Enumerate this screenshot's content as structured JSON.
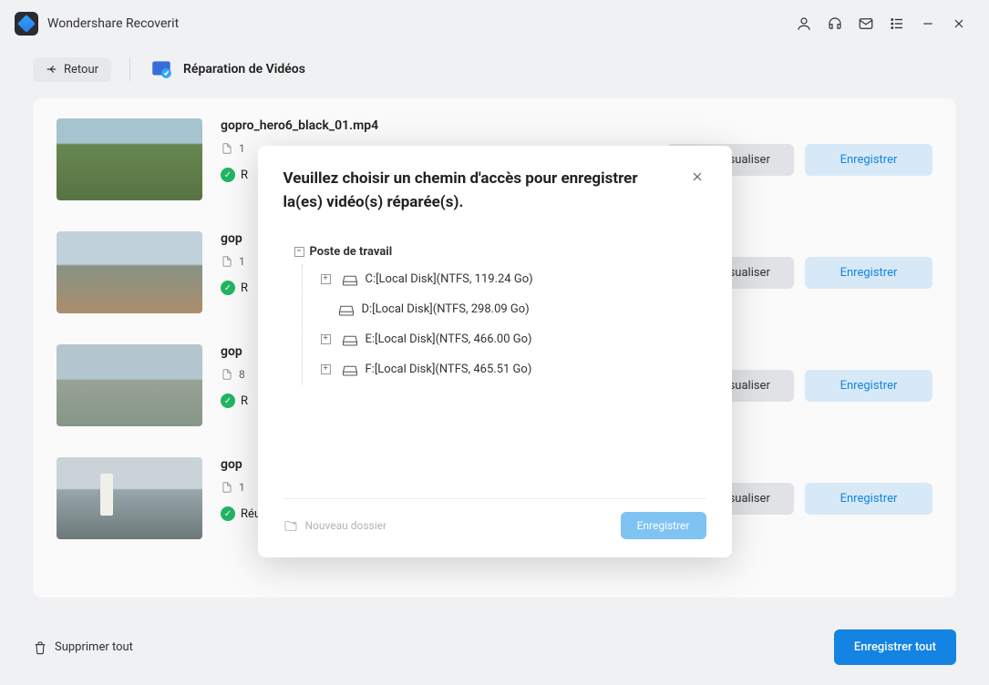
{
  "app": {
    "title": "Wondershare Recoverit"
  },
  "header": {
    "back": "Retour",
    "section": "Réparation de Vidéos"
  },
  "videos": [
    {
      "name": "gopro_hero6_black_01.mp4",
      "size": "1",
      "status": "R"
    },
    {
      "name": "gop",
      "size": "1",
      "status": "R"
    },
    {
      "name": "gop",
      "size": "8",
      "status": "R"
    },
    {
      "name": "gop",
      "size": "1",
      "status": "Réussi"
    }
  ],
  "actions": {
    "preview": "Prévisualiser",
    "save": "Enregistrer"
  },
  "footer": {
    "delete_all": "Supprimer tout",
    "save_all": "Enregistrer tout"
  },
  "modal": {
    "title": "Veuillez choisir un chemin d'accès pour enregistrer la(es) vidéo(s) réparée(s).",
    "root": "Poste de travail",
    "drives": [
      {
        "label": "C:[Local Disk](NTFS, 119.24 Go)",
        "expandable": true
      },
      {
        "label": "D:[Local Disk](NTFS, 298.09 Go)",
        "expandable": false
      },
      {
        "label": "E:[Local Disk](NTFS, 466.00 Go)",
        "expandable": true
      },
      {
        "label": "F:[Local Disk](NTFS, 465.51 Go)",
        "expandable": true
      }
    ],
    "new_folder": "Nouveau dossier",
    "save_btn": "Enregistrer"
  }
}
